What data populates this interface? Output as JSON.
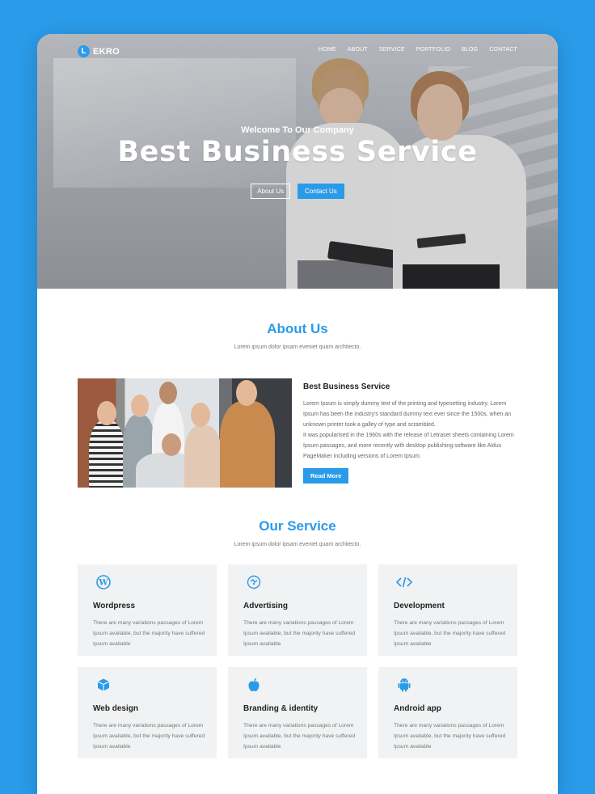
{
  "brand": {
    "logo_letter": "L",
    "name": "EKRO",
    "accent": "#2a9be8"
  },
  "nav": [
    "HOME",
    "ABOUT",
    "SERVICE",
    "PORTFOLIO",
    "BLOG",
    "CONTACT"
  ],
  "hero": {
    "subtitle": "Welcome To Our Company",
    "title": "Best Business Service",
    "btn_about": "About Us",
    "btn_contact": "Contact Us"
  },
  "about": {
    "title": "About Us",
    "subtitle": "Lorem ipsum dolor ipsam eveniet quam architecto.",
    "heading": "Best Business Service",
    "para1": "Lorem Ipsum is simply dummy text of the printing and typesetting industry. Lorem Ipsum has been the industry's standard dummy text ever since the 1500s, when an unknown printer took a galley of type and scrambled.",
    "para2": "It was popularised in the 1960s with the release of Letraset sheets containing Lorem Ipsum passages, and more recently with desktop publishing software like Aldus PageMaker including versions of Lorem Ipsum.",
    "read_more": "Read More"
  },
  "services": {
    "title": "Our Service",
    "subtitle": "Lorem ipsum dolor ipsam eveniet quam architecto.",
    "items": [
      {
        "icon": "wordpress-icon",
        "title": "Wordpress",
        "text": "There are many variations passages of Lorem Ipsum available, but the majority have suffered Ipsum available"
      },
      {
        "icon": "advertising-icon",
        "title": "Advertising",
        "text": "There are many variations passages of Lorem Ipsum available, but the majority have suffered Ipsum available"
      },
      {
        "icon": "code-icon",
        "title": "Development",
        "text": "There are many variations passages of Lorem Ipsum available, but the majority have suffered Ipsum available"
      },
      {
        "icon": "cube-icon",
        "title": "Web design",
        "text": "There are many variations passages of Lorem Ipsum available, but the majority have suffered Ipsum available"
      },
      {
        "icon": "apple-icon",
        "title": "Branding & identity",
        "text": "There are many variations passages of Lorem Ipsum available, but the majority have suffered Ipsum available"
      },
      {
        "icon": "android-icon",
        "title": "Android app",
        "text": "There are many variations passages of Lorem Ipsum available, but the majority have suffered Ipsum available"
      }
    ]
  }
}
